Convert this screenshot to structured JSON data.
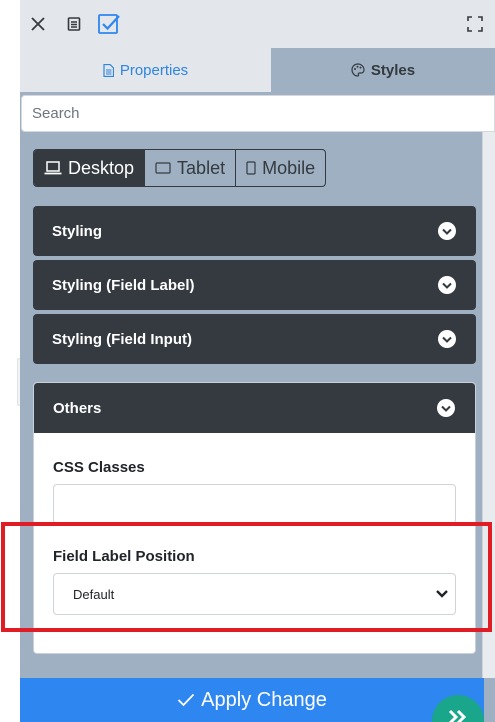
{
  "topbar": {
    "close_icon": "close-icon",
    "doc_icon": "document-icon",
    "check_icon": "checkbox-icon",
    "expand_icon": "fullscreen-icon"
  },
  "tabs": [
    {
      "label": "Properties",
      "icon": "file-icon",
      "active": false
    },
    {
      "label": "Styles",
      "icon": "palette-icon",
      "active": true
    }
  ],
  "search": {
    "placeholder": "Search",
    "value": ""
  },
  "devices": [
    {
      "label": "Desktop",
      "icon": "laptop-icon",
      "active": true
    },
    {
      "label": "Tablet",
      "icon": "tablet-icon",
      "active": false
    },
    {
      "label": "Mobile",
      "icon": "mobile-icon",
      "active": false
    }
  ],
  "sections": [
    {
      "label": "Styling",
      "open": false
    },
    {
      "label": "Styling (Field Label)",
      "open": false
    },
    {
      "label": "Styling (Field Input)",
      "open": false
    },
    {
      "label": "Others",
      "open": true
    }
  ],
  "others": {
    "css_classes_label": "CSS Classes",
    "css_classes_value": "",
    "field_label_position_label": "Field Label Position",
    "field_label_position_value": "Default"
  },
  "apply": {
    "label": "Apply Change",
    "icon": "check-icon"
  },
  "colors": {
    "accent": "#2e86f0",
    "dark": "#343a40",
    "panel_bg": "#9eb0c1",
    "highlight": "#e01d24",
    "fab": "#1aa68a"
  }
}
